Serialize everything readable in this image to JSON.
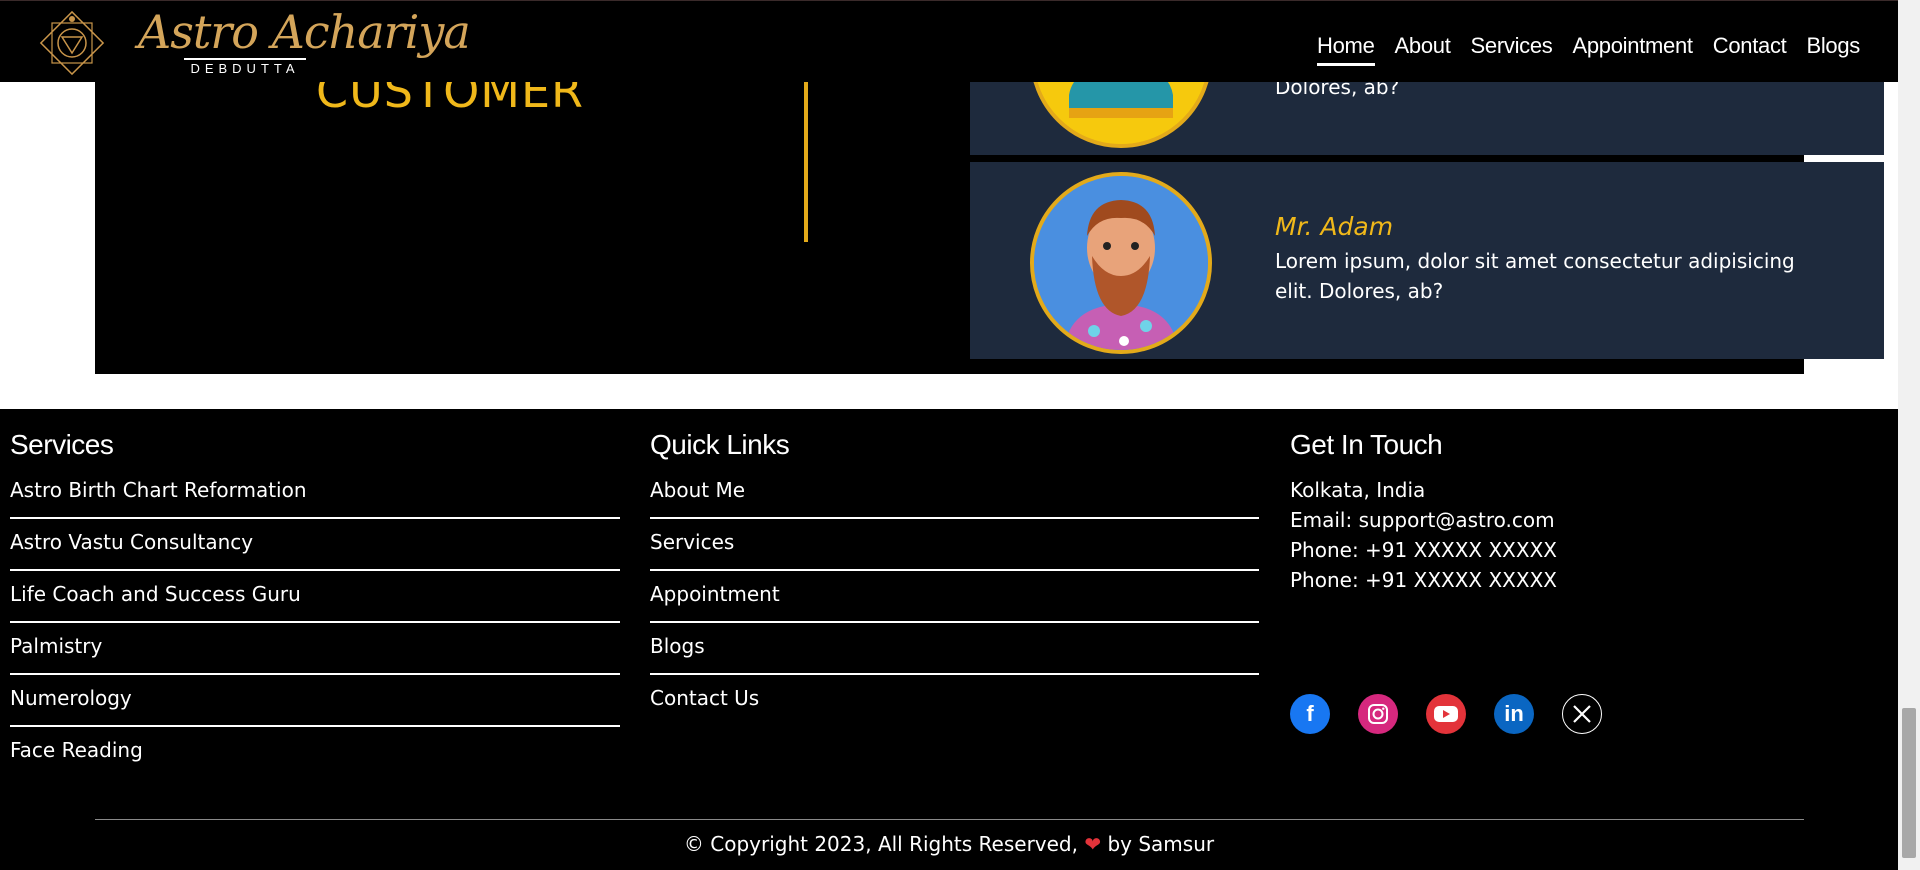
{
  "header": {
    "logo_text": "Astro Achariya",
    "logo_subtext": "DEBDUTTA",
    "nav": [
      {
        "label": "Home",
        "active": true
      },
      {
        "label": "About"
      },
      {
        "label": "Services"
      },
      {
        "label": "Appointment"
      },
      {
        "label": "Contact"
      },
      {
        "label": "Blogs"
      }
    ]
  },
  "testimonials": {
    "title_fragment": "CUSTOMER",
    "cards": [
      {
        "name": "",
        "text": "Dolores, ab?"
      },
      {
        "name": "Mr. Adam",
        "text": "Lorem ipsum, dolor sit amet consectetur adipisicing elit. Dolores, ab?"
      }
    ]
  },
  "footer": {
    "services": {
      "heading": "Services",
      "items": [
        "Astro Birth Chart Reformation",
        "Astro Vastu Consultancy",
        "Life Coach and Success Guru",
        "Palmistry",
        "Numerology",
        "Face Reading"
      ]
    },
    "quick_links": {
      "heading": "Quick Links",
      "items": [
        "About Me",
        "Services",
        "Appointment",
        "Blogs",
        "Contact Us"
      ]
    },
    "contact": {
      "heading": "Get In Touch",
      "location": "Kolkata, India",
      "email": "Email: support@astro.com",
      "phone1": "Phone: +91 XXXXX XXXXX",
      "phone2": "Phone: +91 XXXXX XXXXX"
    },
    "social_icons": [
      "facebook-icon",
      "instagram-icon",
      "youtube-icon",
      "linkedin-icon",
      "x-twitter-icon"
    ],
    "copyright_prefix": "© Copyright 2023, All Rights Reserved,",
    "copyright_suffix": "by Samsur"
  },
  "colors": {
    "accent_gold": "#f0b81a",
    "card_bg": "#1e2a3d",
    "footer_bg": "#000000"
  }
}
